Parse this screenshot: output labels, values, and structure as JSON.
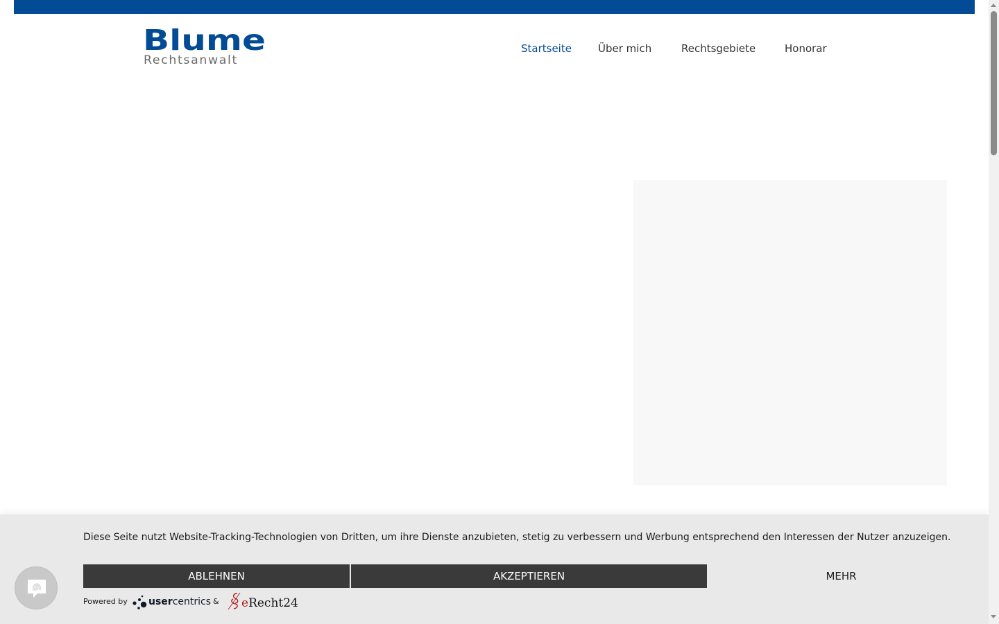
{
  "header": {
    "logo": {
      "main": "Blume",
      "sub": "Rechtsanwalt"
    },
    "nav": [
      {
        "label": "Startseite",
        "active": true
      },
      {
        "label": "Über mich",
        "active": false
      },
      {
        "label": "Rechtsgebiete",
        "active": false
      },
      {
        "label": "Honorar",
        "active": false
      }
    ]
  },
  "consent": {
    "text": "Diese Seite nutzt Website-Tracking-Technologien von Dritten, um ihre Dienste anzubieten, stetig zu verbessern und Werbung entsprechend den Interessen der Nutzer anzuzeigen.",
    "decline_label": "ABLEHNEN",
    "accept_label": "AKZEPTIEREN",
    "more_label": "MEHR",
    "powered_by": "Powered by",
    "uc_brand_bold": "user",
    "uc_brand_rest": "centrics",
    "ampersand": "&",
    "erecht_e": "e",
    "erecht_rest": "Recht24"
  },
  "colors": {
    "brand": "#034b94",
    "banner_bg": "#e9e9e9",
    "button_dark": "#3a3a3a"
  },
  "icons": {
    "privacy_fab": "fingerprint-icon"
  }
}
